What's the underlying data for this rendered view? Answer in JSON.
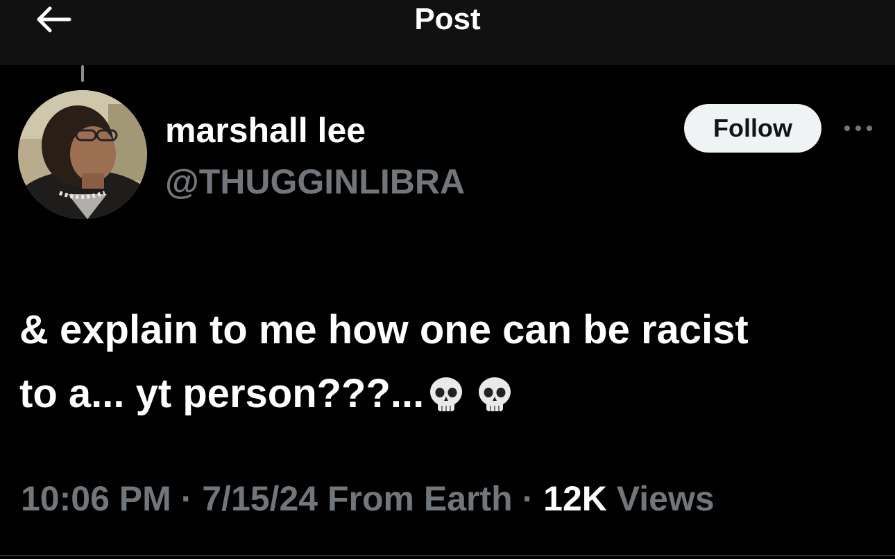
{
  "header": {
    "title": "Post",
    "back_icon": "arrow-left-icon"
  },
  "author": {
    "display_name": "marshall lee",
    "handle": "@THUGGINLIBRA",
    "follow_label": "Follow",
    "more_icon": "more-horizontal-icon"
  },
  "post": {
    "text_line1": "& explain to me how one can be racist",
    "text_line2": "to a... yt person???...",
    "emoji": [
      "skull-emoji",
      "skull-emoji"
    ],
    "time": "10:06 PM",
    "separator": "·",
    "date": "7/15/24",
    "source": "From Earth",
    "views_count": "12K",
    "views_label": "Views"
  },
  "colors": {
    "background": "#000000",
    "topbar": "#111111",
    "muted_text": "#71767b",
    "follow_button_bg": "#eff3f4",
    "follow_button_text": "#0f1419"
  }
}
